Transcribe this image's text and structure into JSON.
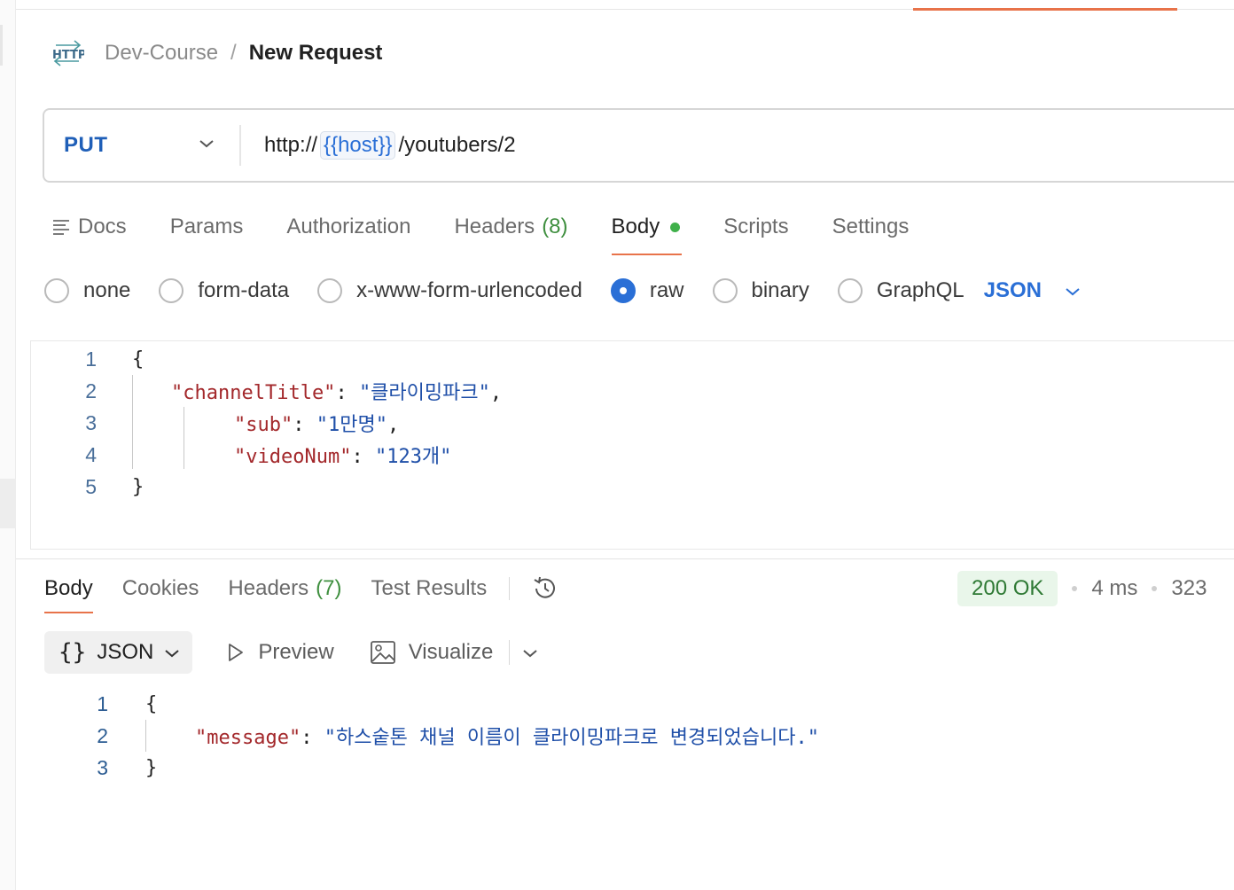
{
  "breadcrumb": {
    "parent": "Dev-Course",
    "separator": "/",
    "current": "New Request",
    "icon": "http-icon"
  },
  "request": {
    "method": "PUT",
    "url_prefix": "http://",
    "url_variable": "{{host}}",
    "url_suffix": "/youtubers/2"
  },
  "request_tabs": {
    "docs": "Docs",
    "params": "Params",
    "authorization": "Authorization",
    "headers": "Headers",
    "headers_count": "(8)",
    "body": "Body",
    "scripts": "Scripts",
    "settings": "Settings"
  },
  "body_types": {
    "none": "none",
    "form_data": "form-data",
    "urlencoded": "x-www-form-urlencoded",
    "raw": "raw",
    "binary": "binary",
    "graphql": "GraphQL",
    "selected": "raw",
    "language": "JSON"
  },
  "request_body": {
    "line_numbers": [
      "1",
      "2",
      "3",
      "4",
      "5"
    ],
    "open_brace": "{",
    "close_brace": "}",
    "key1": "\"channelTitle\"",
    "val1": "\"클라이밍파크\"",
    "key2": "\"sub\"",
    "val2": "\"1만명\"",
    "key3": "\"videoNum\"",
    "val3": "\"123개\"",
    "colon": ": ",
    "comma": ","
  },
  "response_tabs": {
    "body": "Body",
    "cookies": "Cookies",
    "headers": "Headers",
    "headers_count": "(7)",
    "test_results": "Test Results"
  },
  "response_status": {
    "status": "200 OK",
    "time": "4 ms",
    "size": "323",
    "status_color": "#2f7a35"
  },
  "response_toolbar": {
    "format_braces": "{}",
    "format": "JSON",
    "preview": "Preview",
    "visualize": "Visualize"
  },
  "response_body": {
    "line_numbers": [
      "1",
      "2",
      "3"
    ],
    "open_brace": "{",
    "close_brace": "}",
    "key": "\"message\"",
    "value": "\"하스숱톤 채널 이름이 클라이밍파크로 변경되었습니다.\"",
    "colon": ": "
  },
  "colors": {
    "accent": "#e8734a",
    "method": "#1f5fb8",
    "link": "#2a6fd6",
    "json_key": "#a3282b",
    "json_string": "#1f4fa8"
  }
}
